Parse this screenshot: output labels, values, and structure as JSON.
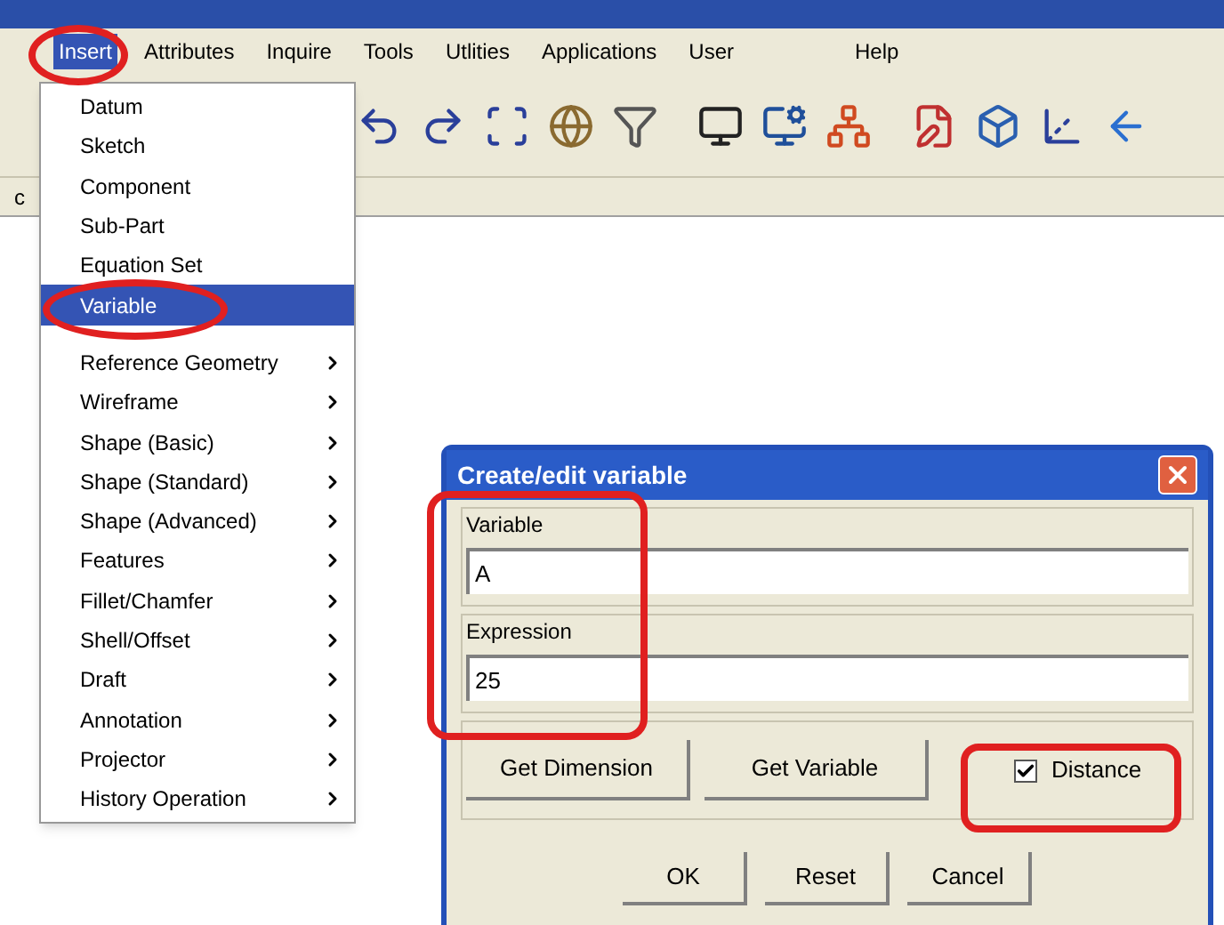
{
  "menubar": [
    {
      "label": "Insert",
      "selected": true
    },
    {
      "label": "Attributes",
      "selected": false
    },
    {
      "label": "Inquire",
      "selected": false
    },
    {
      "label": "Tools",
      "selected": false
    },
    {
      "label": "Utlities",
      "selected": false
    },
    {
      "label": "Applications",
      "selected": false
    },
    {
      "label": "User",
      "selected": false
    },
    {
      "label": "Help",
      "selected": false
    }
  ],
  "side_strip": {
    "label": "c"
  },
  "insert_menu": {
    "items": [
      {
        "label": "Datum",
        "submenu": false,
        "selected": false
      },
      {
        "label": "Sketch",
        "submenu": false,
        "selected": false
      },
      {
        "label": "Component",
        "submenu": false,
        "selected": false
      },
      {
        "label": "Sub-Part",
        "submenu": false,
        "selected": false
      },
      {
        "label": "Equation Set",
        "submenu": false,
        "selected": false
      },
      {
        "label": "Variable",
        "submenu": false,
        "selected": true
      },
      {
        "label": "Reference Geometry",
        "submenu": true,
        "selected": false
      },
      {
        "label": "Wireframe",
        "submenu": true,
        "selected": false
      },
      {
        "label": "Shape (Basic)",
        "submenu": true,
        "selected": false
      },
      {
        "label": "Shape (Standard)",
        "submenu": true,
        "selected": false
      },
      {
        "label": "Shape (Advanced)",
        "submenu": true,
        "selected": false
      },
      {
        "label": "Features",
        "submenu": true,
        "selected": false
      },
      {
        "label": "Fillet/Chamfer",
        "submenu": true,
        "selected": false
      },
      {
        "label": "Shell/Offset",
        "submenu": true,
        "selected": false
      },
      {
        "label": "Draft",
        "submenu": true,
        "selected": false
      },
      {
        "label": "Annotation",
        "submenu": true,
        "selected": false
      },
      {
        "label": "Projector",
        "submenu": true,
        "selected": false
      },
      {
        "label": "History Operation",
        "submenu": true,
        "selected": false
      }
    ]
  },
  "dialog": {
    "title": "Create/edit variable",
    "fields": [
      {
        "label": "Variable",
        "value": "A"
      },
      {
        "label": "Expression",
        "value": "25"
      }
    ],
    "actions": [
      "Get Dimension",
      "Get Variable"
    ],
    "distance_checkbox": {
      "label": "Distance",
      "checked": true
    },
    "buttons": [
      "OK",
      "Reset",
      "Cancel"
    ]
  }
}
